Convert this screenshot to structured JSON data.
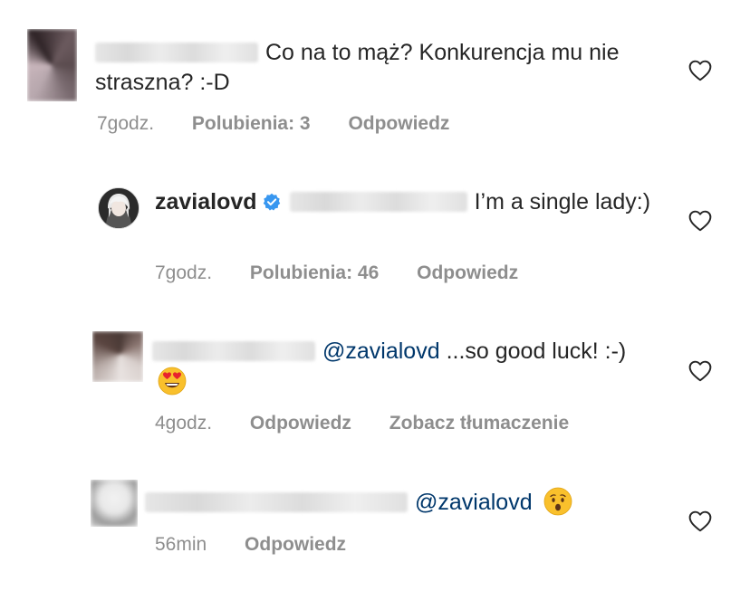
{
  "comments": [
    {
      "text": "Co na to mąż? Konkurencja mu nie straszna? :-D",
      "time": "7godz.",
      "likes": "Polubienia: 3",
      "reply": "Odpowiedz"
    },
    {
      "username": "zavialovd",
      "text": "I’m a single lady:)",
      "time": "7godz.",
      "likes": "Polubienia: 46",
      "reply": "Odpowiedz"
    },
    {
      "mention": "@zavialovd",
      "text": "...so good luck! :-)",
      "time": "4godz.",
      "reply": "Odpowiedz",
      "translate": "Zobacz tłumaczenie"
    },
    {
      "mention": "@zavialovd",
      "time": "56min",
      "reply": "Odpowiedz"
    }
  ],
  "icons": {
    "heart": "heart-outline-icon",
    "verified": "verified-badge-icon",
    "emoji_heart_eyes": "heart-eyes-emoji",
    "emoji_surprised": "hushed-face-emoji"
  },
  "colors": {
    "text": "#262626",
    "meta": "#8e8e8e",
    "mention": "#00376b",
    "verified": "#3897f0"
  }
}
